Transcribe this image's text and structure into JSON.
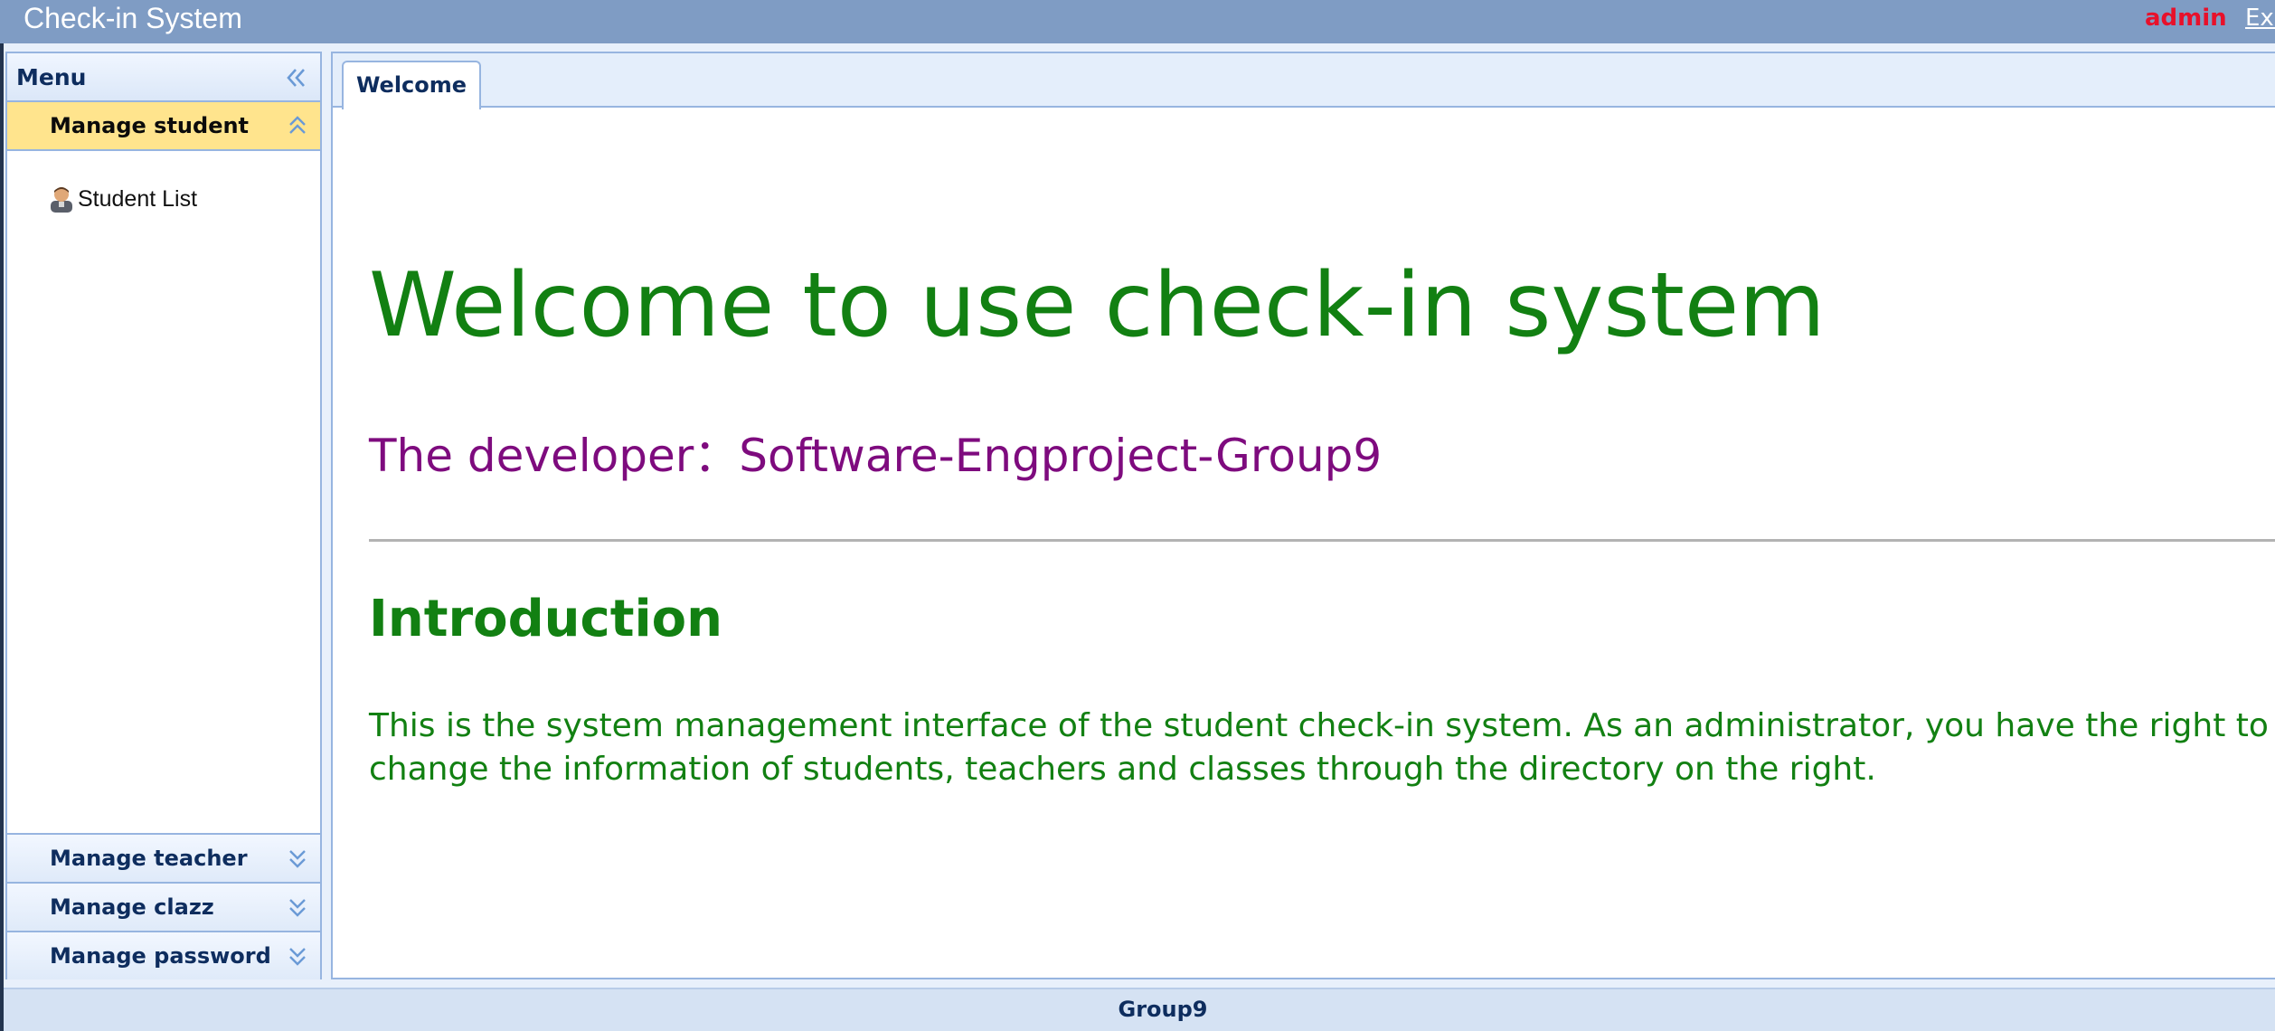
{
  "header": {
    "title": "Check-in System",
    "user": "admin",
    "exit_label": "Exit"
  },
  "sidebar": {
    "title": "Menu",
    "sections": [
      {
        "label": "Manage student",
        "expanded": true,
        "items": [
          {
            "label": "Student List",
            "icon": "student-icon"
          }
        ]
      },
      {
        "label": "Manage teacher",
        "expanded": false
      },
      {
        "label": "Manage clazz",
        "expanded": false
      },
      {
        "label": "Manage password",
        "expanded": false
      }
    ]
  },
  "tabs": [
    {
      "label": "Welcome",
      "active": true
    }
  ],
  "content": {
    "welcome_title": "Welcome to use check-in system",
    "developer": "The developer：Software-Engproject-Group9",
    "intro_heading": "Introduction",
    "intro_text": "This is the system management interface of the student check-in system. As an administrator, you have the right to change the information of students, teachers and classes through the directory on the right."
  },
  "footer": {
    "text": "Group9"
  },
  "colors": {
    "header_bg": "#7f9cc4",
    "accent_green": "#128012",
    "accent_purple": "#7e0b7e",
    "user_red": "#e8102a",
    "active_menu_bg": "#ffe48d",
    "panel_border": "#97b5e0"
  }
}
